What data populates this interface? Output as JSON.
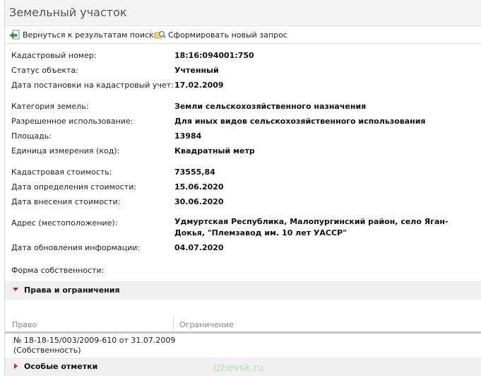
{
  "title": "Земельный участок",
  "toolbar": {
    "back_label": "Вернуться к результатам поиска",
    "new_query_label": "Сформировать новый запрос"
  },
  "fields": [
    {
      "label": "Кадастровый номер:",
      "value": "18:16:094001:750"
    },
    {
      "label": "Статус объекта:",
      "value": "Учтенный"
    },
    {
      "label": "Дата постановки на кадастровый учет:",
      "value": "17.02.2009"
    },
    {
      "label": "Категория земель:",
      "value": "Земли сельскохозяйственного назначения"
    },
    {
      "label": "Разрешенное использование:",
      "value": "Для иных видов сельскохозяйственного использования"
    },
    {
      "label": "Площадь:",
      "value": "13984"
    },
    {
      "label": "Единица измерения (код):",
      "value": "Квадратный метр"
    },
    {
      "label": "Кадастровая стоимость:",
      "value": "73555,84"
    },
    {
      "label": "Дата определения стоимости:",
      "value": "15.06.2020"
    },
    {
      "label": "Дата внесения стоимости:",
      "value": "30.06.2020"
    },
    {
      "label": "Адрес (местоположение):",
      "value": "Удмуртская Республика, Малопургинский район, село Яган-Докья, \"Племзавод им. 10 лет УАССР\""
    },
    {
      "label": "Дата обновления информации:",
      "value": "04.07.2020"
    },
    {
      "label": "Форма собственности:",
      "value": ""
    }
  ],
  "rights_section": {
    "title": "Права и ограничения",
    "columns": [
      "Право",
      "Ограничение"
    ],
    "rows": [
      {
        "right_line1": "№ 18-18-15/003/2009-610  от 31.07.2009",
        "right_line2": "(Собственность)",
        "restriction": ""
      }
    ]
  },
  "special_section": {
    "title": "Особые отметки"
  },
  "watermark": "izhevsk.ru",
  "colors": {
    "arrow": "#cc2222",
    "header_bg": "#f4f4f4",
    "section_bg": "#f0f0f0"
  }
}
